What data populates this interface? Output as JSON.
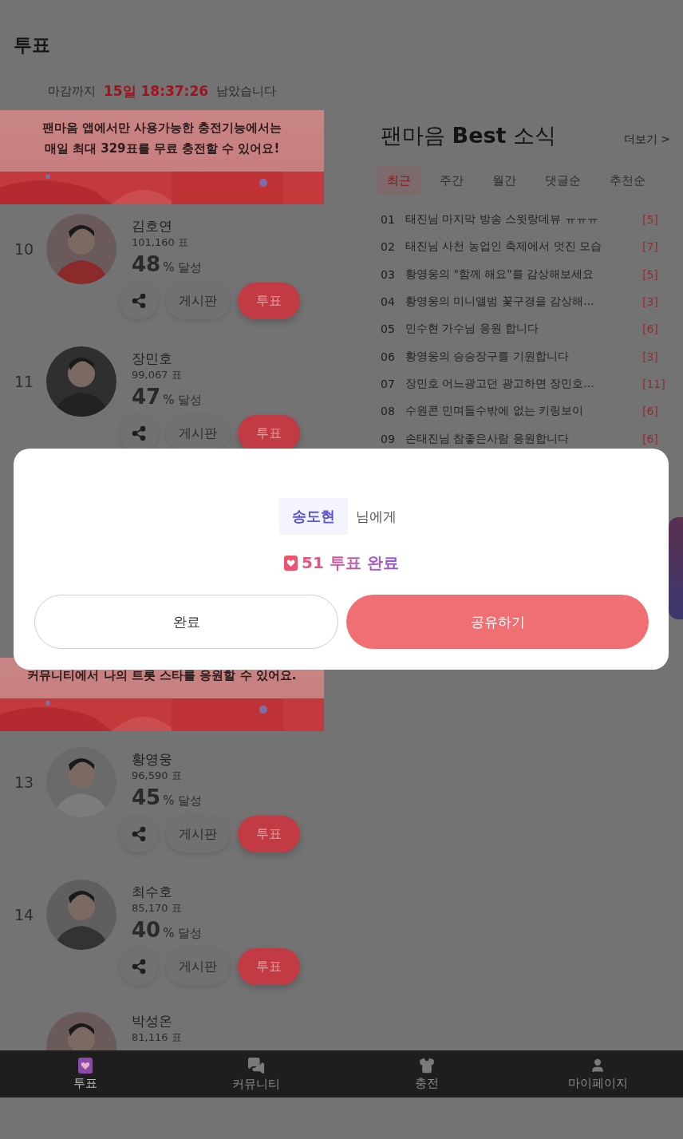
{
  "header": {
    "title": "투표"
  },
  "countdown": {
    "prefix": "마감까지",
    "time": "15일 18:37:26",
    "suffix": "남았습니다"
  },
  "ranking": [
    {
      "kind": "banner",
      "lines": [
        "팬마음 앱에서만 사용가능한 충전기능에서는",
        "매일 최대 329표를 무료 충전할 수 있어요!"
      ]
    },
    {
      "kind": "candidate",
      "rank": "10",
      "name": "김호연",
      "votes": "101,160 표",
      "percent": "48",
      "percent_label": "% 달성",
      "board": "게시판",
      "vote": "투표"
    },
    {
      "kind": "candidate",
      "rank": "11",
      "name": "장민호",
      "votes": "99,067 표",
      "percent": "47",
      "percent_label": "% 달성",
      "board": "게시판",
      "vote": "투표"
    }
  ],
  "ranking_continued": [
    {
      "kind": "banner",
      "lines": [
        "커뮤니티에서 나의 트롯 스타를 응원할 수 있어요."
      ]
    },
    {
      "kind": "candidate",
      "rank": "13",
      "name": "황영웅",
      "votes": "96,590 표",
      "percent": "45",
      "percent_label": "% 달성",
      "board": "게시판",
      "vote": "투표"
    },
    {
      "kind": "candidate",
      "rank": "14",
      "name": "최수호",
      "votes": "85,170 표",
      "percent": "40",
      "percent_label": "% 달성",
      "board": "게시판",
      "vote": "투표"
    },
    {
      "kind": "candidate",
      "name": "박성온",
      "votes": "81,116 표"
    }
  ],
  "best_news": {
    "title": "팬마음 **Best** 소식",
    "more": "더보기 >",
    "tabs": [
      {
        "label": "최근",
        "selected": true
      },
      {
        "label": "주간",
        "selected": false
      },
      {
        "label": "월간",
        "selected": false
      },
      {
        "label": "댓글순",
        "selected": false
      },
      {
        "label": "추천순",
        "selected": false
      }
    ],
    "items": [
      {
        "number": "01",
        "title": "태진님 마지막 방송 스윗랑데뷰 ㅠㅠㅠ",
        "count": "[5]"
      },
      {
        "number": "02",
        "title": "태진님 사천 농업인 축제에서 멋진 모습",
        "count": "[7]"
      },
      {
        "number": "03",
        "title": "황영웅의 \"함께 해요\"를 감상해보세요",
        "count": "[5]"
      },
      {
        "number": "04",
        "title": "황영웅의 미니앨범 꽃구경을 감상해...",
        "count": "[3]"
      },
      {
        "number": "05",
        "title": "민수현 가수님 응원 합니다",
        "count": "[6]"
      },
      {
        "number": "06",
        "title": "황영웅의 승승장구를 기원합니다",
        "count": "[3]"
      },
      {
        "number": "07",
        "title": "장민호 어느광고던 광고하면 장민호...",
        "count": "[11]"
      },
      {
        "number": "08",
        "title": "수원콘 민며들수밖에 없는 키링보이",
        "count": "[6]"
      },
      {
        "number": "09",
        "title": "손태진님 참좋은사람 응원합니다",
        "count": "[6]"
      }
    ]
  },
  "dialog": {
    "recipient": "송도현",
    "recipient_suffix": "님에게",
    "result": "51 투표 완료",
    "buttons": [
      {
        "label": "완료",
        "kind": "secondary"
      },
      {
        "label": "공유하기",
        "kind": "primary"
      }
    ]
  },
  "bottom_nav": [
    {
      "label": "투표",
      "kind": "vote",
      "selected": true
    },
    {
      "label": "커뮤니티",
      "kind": "community",
      "selected": false
    },
    {
      "label": "충전",
      "kind": "charge",
      "selected": false
    },
    {
      "label": "마이페이지",
      "kind": "profile",
      "selected": false
    }
  ]
}
